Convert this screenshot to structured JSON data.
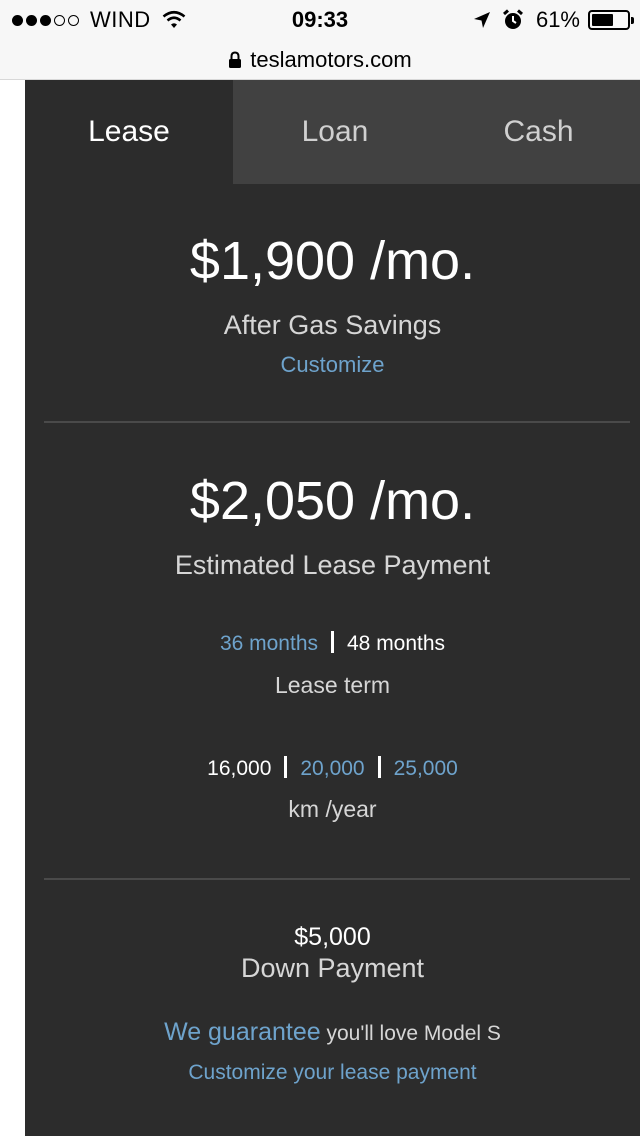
{
  "statusbar": {
    "carrier": "WIND",
    "signal_bars_filled": 3,
    "signal_bars_total": 5,
    "time": "09:33",
    "battery": "61%",
    "battery_level": 0.61,
    "icons": [
      "wifi-icon",
      "location-arrow-icon",
      "alarm-clock-icon",
      "battery-icon"
    ]
  },
  "urlbar": {
    "url": "teslamotors.com",
    "icon": "lock-icon"
  },
  "tabs": [
    {
      "label": "Lease",
      "active": true
    },
    {
      "label": "Loan",
      "active": false
    },
    {
      "label": "Cash",
      "active": false
    }
  ],
  "gas_savings": {
    "price": "$1,900 /mo.",
    "label": "After Gas Savings",
    "customize": "Customize"
  },
  "lease_payment": {
    "price": "$2,050 /mo.",
    "label": "Estimated Lease Payment"
  },
  "lease_term": {
    "options": [
      {
        "label": "36 months",
        "selected": false
      },
      {
        "label": "48 months",
        "selected": true
      }
    ],
    "label": "Lease term"
  },
  "distance": {
    "options": [
      {
        "label": "16,000",
        "selected": true
      },
      {
        "label": "20,000",
        "selected": false
      },
      {
        "label": "25,000",
        "selected": false
      }
    ],
    "label": "km /year"
  },
  "down_payment": {
    "amount": "$5,000",
    "label": "Down Payment"
  },
  "guarantee": {
    "link": "We guarantee",
    "text": "you'll love Model S"
  },
  "customize_lease": "Customize your lease payment",
  "colors": {
    "panel_bg": "#2c2c2c",
    "inactive_tab_bg": "#414141",
    "link_blue": "#6ea3cc",
    "divider": "#4a4a4a"
  }
}
